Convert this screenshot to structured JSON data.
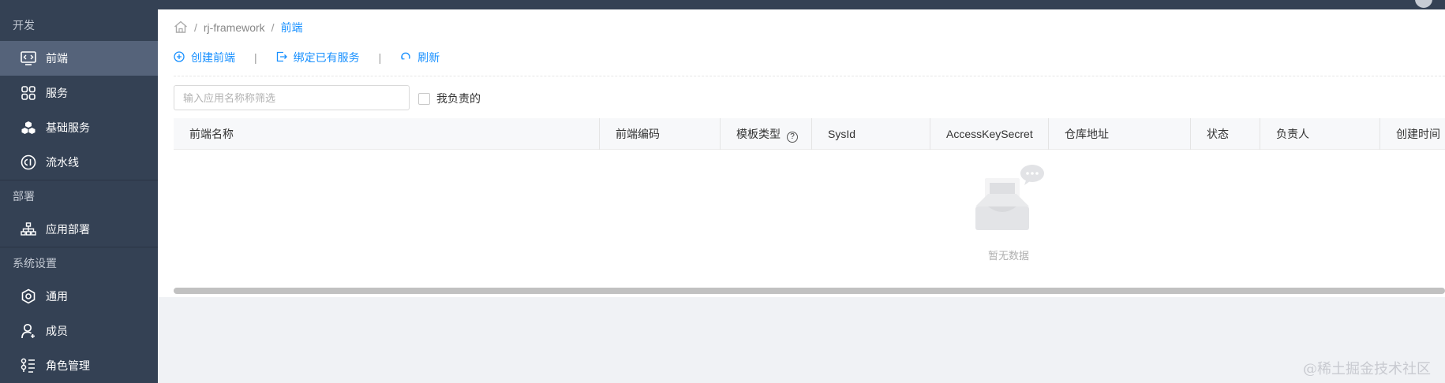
{
  "sidebar": {
    "groups": [
      {
        "title": "开发",
        "items": [
          {
            "label": "前端",
            "icon": "frontend-code-icon",
            "active": true
          },
          {
            "label": "服务",
            "icon": "grid-icon"
          },
          {
            "label": "基础服务",
            "icon": "cubes-icon"
          },
          {
            "label": "流水线",
            "icon": "ci-icon"
          }
        ]
      },
      {
        "title": "部署",
        "items": [
          {
            "label": "应用部署",
            "icon": "sitemap-icon"
          }
        ]
      },
      {
        "title": "系统设置",
        "items": [
          {
            "label": "通用",
            "icon": "hexagon-settings-icon"
          },
          {
            "label": "成员",
            "icon": "user-icon"
          },
          {
            "label": "角色管理",
            "icon": "role-list-icon"
          }
        ]
      }
    ]
  },
  "breadcrumb": {
    "home_icon": "home-icon",
    "project": "rj-framework",
    "current": "前端"
  },
  "toolbar": {
    "create_label": "创建前端",
    "bind_label": "绑定已有服务",
    "refresh_label": "刷新",
    "separator": "|"
  },
  "filter": {
    "placeholder": "输入应用名称称筛选",
    "value": "",
    "mine_label": "我负责的"
  },
  "table": {
    "columns": [
      "前端名称",
      "前端编码",
      "模板类型",
      "SysId",
      "AccessKeySecret",
      "仓库地址",
      "状态",
      "负责人",
      "创建时间"
    ],
    "help_glyph": "?",
    "rows": [],
    "empty_text": "暂无数据"
  },
  "watermark": "@稀土掘金技术社区",
  "colors": {
    "sidebar_bg": "#344154",
    "sidebar_active": "#55637a",
    "accent": "#1890ff",
    "page_bg": "#f0f2f5"
  }
}
